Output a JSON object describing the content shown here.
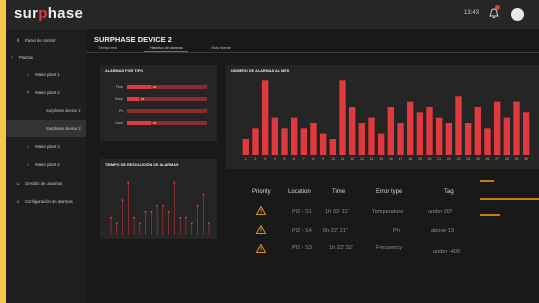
{
  "app": {
    "logo_prefix": "sur",
    "logo_mid": "p",
    "logo_suffix": "hase",
    "time": "13:43",
    "notification_count": "",
    "colors": {
      "accent": "#e03a3e",
      "bar_track": "#8d2b2e",
      "tag_line": "#c87a1a",
      "warning": "#f0a020"
    }
  },
  "sidebar": {
    "items": [
      {
        "label": "Panel de control",
        "icon": "chart-icon"
      },
      {
        "label": "Plantas",
        "icon": "share-icon"
      },
      {
        "label": "Water plant 1",
        "icon": "chevron-icon"
      },
      {
        "label": "Water plant 2",
        "icon": "chevron-icon"
      },
      {
        "label": "Surphase device 1",
        "icon": ""
      },
      {
        "label": "Surphase device 2",
        "icon": ""
      },
      {
        "label": "Water plant 3",
        "icon": "chevron-icon"
      },
      {
        "label": "Water plant 4",
        "icon": "chevron-icon"
      },
      {
        "label": "Gestión de usuarios",
        "icon": "users-icon"
      },
      {
        "label": "Configuración de alarmas",
        "icon": "bell-icon"
      }
    ]
  },
  "main": {
    "title": "SURPHASE DEVICE 2",
    "tabs": [
      "Tiempo real",
      "Histórico de alarmas",
      "Vista tiberde"
    ]
  },
  "cards": {
    "alarm_type": "ALARMAS POR TIPO",
    "alarms_month": "NÚMERO DE ALARMAS AL MES",
    "resolution_time": "TIEMPO DE RESOLUCIÓN DE ALARMAS"
  },
  "alarm_types": [
    {
      "label": "Flow",
      "value": "24",
      "fraction": 0.3
    },
    {
      "label": "Temp",
      "value": "18",
      "fraction": 0.15
    },
    {
      "label": "Ph",
      "value": "",
      "fraction": 0.0
    },
    {
      "label": "Level",
      "value": "16",
      "fraction": 0.3
    }
  ],
  "chart_data": [
    {
      "type": "bar",
      "title": "NÚMERO DE ALARMAS AL MES",
      "categories": [
        "1",
        "2",
        "3",
        "4",
        "5",
        "6",
        "7",
        "8",
        "9",
        "10",
        "11",
        "12",
        "13",
        "14",
        "15",
        "16",
        "17",
        "18",
        "19",
        "20",
        "21",
        "22",
        "23",
        "24",
        "25",
        "26",
        "27",
        "28",
        "29",
        "30"
      ],
      "values": [
        3,
        5,
        14,
        7,
        5,
        7,
        5,
        6,
        4,
        3,
        14,
        9,
        6,
        7,
        4,
        9,
        6,
        10,
        8,
        9,
        7,
        6,
        11,
        6,
        9,
        5,
        10,
        7,
        10,
        8
      ],
      "ylim": [
        0,
        15
      ]
    },
    {
      "type": "scatter",
      "title": "TIEMPO DE RESOLUCIÓN DE ALARMAS",
      "x": [
        1,
        2,
        3,
        4,
        5,
        6,
        7,
        8,
        9,
        10,
        11,
        12,
        13,
        14,
        15,
        16,
        17,
        18
      ],
      "values": [
        3,
        2,
        6,
        9,
        3,
        2,
        4,
        4,
        5,
        5,
        4,
        9,
        3,
        3,
        2,
        5,
        7,
        2
      ],
      "ylim": [
        0,
        10
      ]
    }
  ],
  "table": {
    "headers": [
      "Priority",
      "Location",
      "Time",
      "Error type",
      "Tag"
    ],
    "rows": [
      {
        "location": "Pl2 - S1",
        "time": "1h 33' 11''",
        "error": "Temperature",
        "tag": "under 20º"
      },
      {
        "location": "Pl2 - S4",
        "time": "6h 22' 21''",
        "error": "Ph",
        "tag": "above 13"
      },
      {
        "location": "Pl2 - S3",
        "time": "1h 23' 32'",
        "error": "Frecuency",
        "tag": "under -400"
      }
    ]
  }
}
